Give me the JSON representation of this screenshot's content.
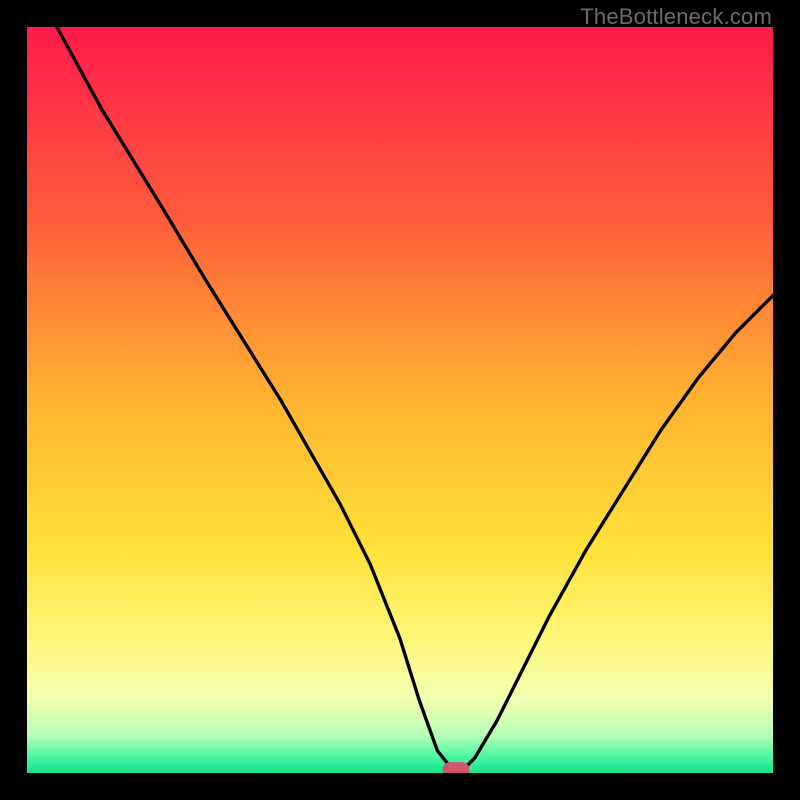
{
  "attribution": "TheBottleneck.com",
  "chart_data": {
    "type": "line",
    "title": "",
    "xlabel": "",
    "ylabel": "",
    "xlim": [
      0,
      100
    ],
    "ylim": [
      0,
      100
    ],
    "grid": false,
    "series": [
      {
        "name": "curve",
        "x": [
          4,
          10,
          18,
          24,
          29,
          34,
          38,
          42,
          46,
          50,
          52.5,
          55,
          57,
          58.5,
          60,
          63,
          66,
          70,
          75,
          80,
          85,
          90,
          95,
          100
        ],
        "y": [
          100,
          89,
          76,
          66,
          58,
          50,
          43,
          36,
          28,
          18,
          10,
          3,
          0.5,
          0.5,
          2,
          7,
          13,
          21,
          30,
          38,
          46,
          53,
          59,
          64
        ]
      }
    ],
    "marker": {
      "x": 57.5,
      "y": 0.5
    },
    "gradient_stops": [
      {
        "pct": 0,
        "color": "#ff1a4b"
      },
      {
        "pct": 25,
        "color": "#ff5a3c"
      },
      {
        "pct": 50,
        "color": "#ffb330"
      },
      {
        "pct": 70,
        "color": "#ffe13a"
      },
      {
        "pct": 82,
        "color": "#fff77a"
      },
      {
        "pct": 90,
        "color": "#f4ffb0"
      },
      {
        "pct": 95,
        "color": "#b6ffb6"
      },
      {
        "pct": 98,
        "color": "#44f5a1"
      },
      {
        "pct": 100,
        "color": "#18e28a"
      }
    ],
    "colors": {
      "curve": "#000000",
      "marker": "#d1576a",
      "frame": "#000000"
    }
  }
}
